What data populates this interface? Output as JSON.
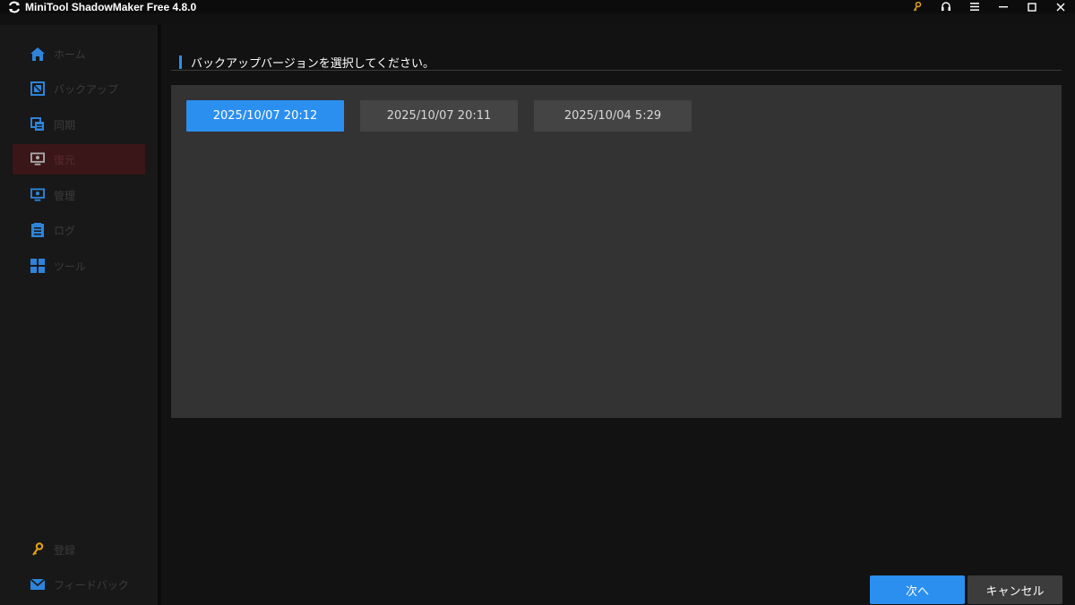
{
  "app": {
    "title": "MiniTool ShadowMaker Free 4.8.0"
  },
  "sidebar": {
    "items": [
      {
        "label": "ホーム",
        "icon": "home-icon"
      },
      {
        "label": "バックアップ",
        "icon": "backup-icon"
      },
      {
        "label": "同期",
        "icon": "sync-icon"
      },
      {
        "label": "復元",
        "icon": "restore-icon",
        "active": true
      },
      {
        "label": "管理",
        "icon": "manage-icon"
      },
      {
        "label": "ログ",
        "icon": "log-icon"
      },
      {
        "label": "ツール",
        "icon": "tools-icon"
      }
    ],
    "bottom": [
      {
        "label": "登録",
        "icon": "key-icon"
      },
      {
        "label": "フィードバック",
        "icon": "mail-icon"
      }
    ]
  },
  "main": {
    "heading": "バックアップバージョンを選択してください。",
    "versions": [
      "2025/10/07 20:12",
      "2025/10/07 20:11",
      "2025/10/04 5:29"
    ],
    "selected_index": 0
  },
  "footer": {
    "next_label": "次へ",
    "cancel_label": "キャンセル"
  },
  "colors": {
    "accent": "#2b8ff0",
    "active_nav": "#3a1618",
    "key_icon": "#e8a317"
  }
}
